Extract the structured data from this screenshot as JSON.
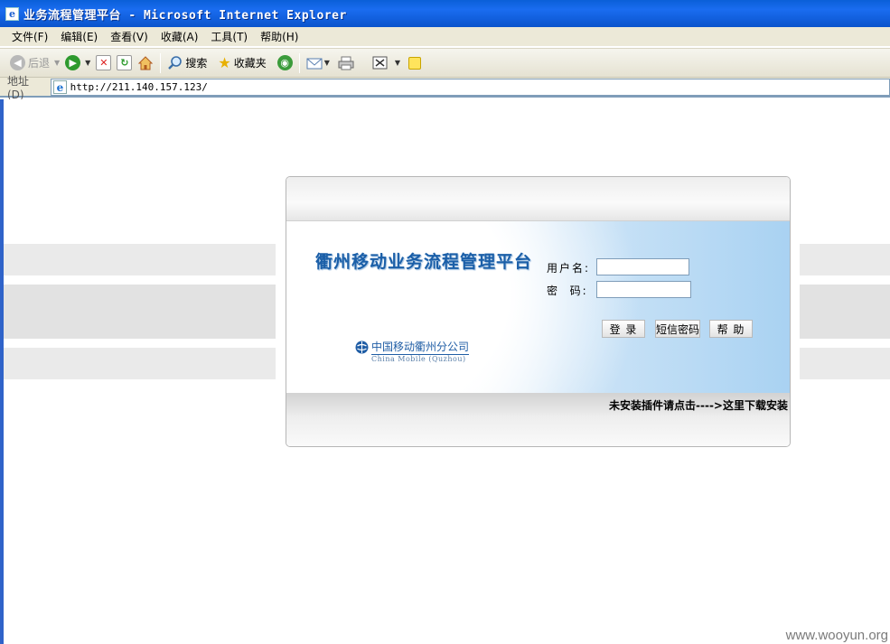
{
  "window": {
    "title": "业务流程管理平台 - Microsoft Internet Explorer"
  },
  "menubar": {
    "items": [
      "文件(F)",
      "编辑(E)",
      "查看(V)",
      "收藏(A)",
      "工具(T)",
      "帮助(H)"
    ]
  },
  "toolbar": {
    "back_label": "后退",
    "search_label": "搜索",
    "favorites_label": "收藏夹"
  },
  "addressbar": {
    "label": "地址(D)",
    "url": "http://211.140.157.123/"
  },
  "login": {
    "platform_title": "衢州移动业务流程管理平台",
    "logo_cn": "中国移动衢州分公司",
    "logo_en": "China Mobile (Quzhou)",
    "username_label": "用户名:",
    "password_label": "密  码:",
    "username_value": "",
    "password_value": "",
    "login_button": "登 录",
    "sms_button": "短信密码",
    "help_button": "帮 助"
  },
  "plugin_note": "未安装插件请点击---->这里下载安装",
  "watermark": "www.wooyun.org",
  "colors": {
    "titlebar": "#0a5fd8",
    "chrome": "#ece9d8",
    "title_text": "#1b5fa8",
    "panel_blue": "#a9d2f2"
  }
}
